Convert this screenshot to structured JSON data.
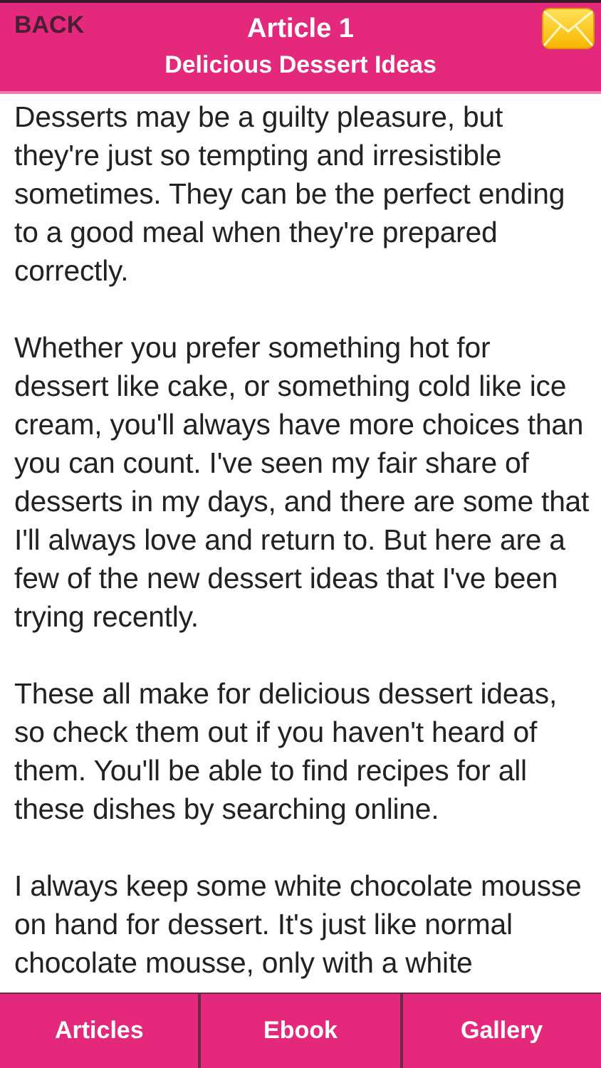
{
  "header": {
    "back": "BACK",
    "title": "Article 1",
    "subtitle": "Delicious Dessert Ideas"
  },
  "article": {
    "paragraphs": [
      "Desserts may be a guilty pleasure, but they're just so tempting and irresistible sometimes. They can be the perfect ending to a good meal when they're prepared correctly.",
      "Whether you prefer something hot for dessert like cake, or something cold like ice cream, you'll always have more choices than you can count. I've seen my fair share of desserts in my days, and there are some that I'll always love and return to. But here are a few of the new dessert ideas that I've been trying recently.",
      "These all make for delicious dessert ideas, so check them out if you haven't heard of them. You'll be able to find recipes for all these dishes by searching online.",
      "I always keep some white chocolate mousse on hand for dessert. It's just like normal chocolate mousse, only with a white"
    ]
  },
  "tab_bar": [
    {
      "label": "Articles"
    },
    {
      "label": "Ebook"
    },
    {
      "label": "Gallery"
    }
  ]
}
